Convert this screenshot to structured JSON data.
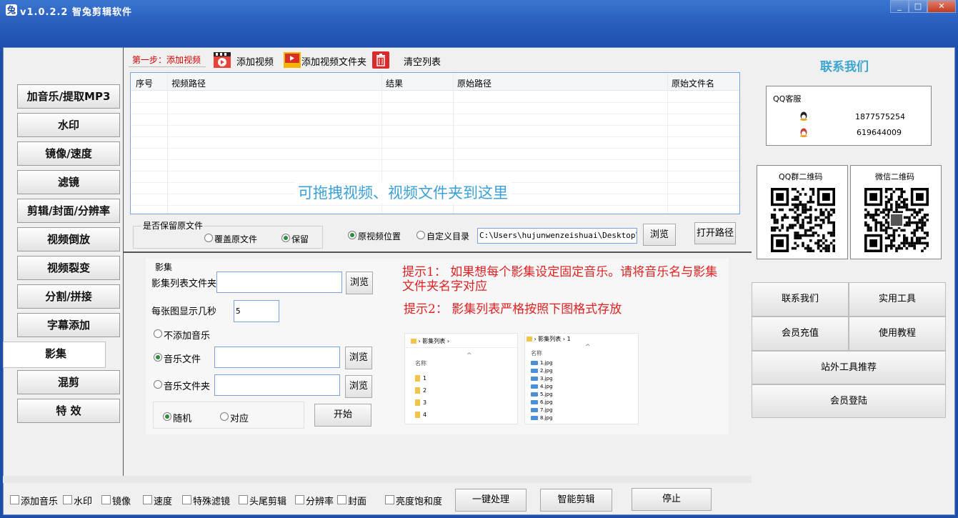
{
  "window": {
    "title": "v1.0.2.2 智兔剪辑软件",
    "minimize": "_",
    "maximize": "□",
    "close": "✕"
  },
  "nav": [
    "加音乐/提取MP3",
    "水印",
    "镜像/速度",
    "滤镜",
    "剪辑/封面/分辨率",
    "视频倒放",
    "视频裂变",
    "分割/拼接",
    "字幕添加",
    "影集",
    "混剪",
    "特 效"
  ],
  "nav_active_index": 9,
  "toolbar": {
    "step": "第一步：添加视频",
    "add_video": "添加视频",
    "add_folder": "添加视频文件夹",
    "clear": "清空列表"
  },
  "table": {
    "columns": [
      "序号",
      "视频路径",
      "结果",
      "原始路径",
      "原始文件名"
    ],
    "drop_hint": "可拖拽视频、视频文件夹到这里"
  },
  "keep": {
    "label": "是否保留原文件",
    "overwrite": "覆盖原文件",
    "keep": "保留",
    "selected": "keep"
  },
  "output": {
    "original": "原视频位置",
    "custom": "自定义目录",
    "path": "C:\\Users\\hujunwenzeishuai\\Desktop\\ztj",
    "browse": "浏览",
    "open": "打开路径",
    "selected": "original"
  },
  "album": {
    "group": "影集",
    "list_folder_label": "影集列表文件夹",
    "list_folder_value": "",
    "browse": "浏览",
    "seconds_label": "每张图显示几秒",
    "seconds_value": "5",
    "no_music": "不添加音乐",
    "music_file": "音乐文件",
    "music_folder": "音乐文件夹",
    "music_selected": "music_file",
    "random": "随机",
    "match": "对应",
    "order_selected": "random",
    "start": "开始"
  },
  "tips": {
    "tip1": "提示1：  如果想每个影集设定固定音乐。请将音乐名与影集文件夹名字对应",
    "tip2": "提示2：  影集列表严格按照下图格式存放"
  },
  "example": {
    "left_crumb": "影集列表",
    "left_header": "名称",
    "left_items": [
      "1",
      "2",
      "3",
      "4"
    ],
    "right_crumb": "影集列表",
    "right_crumb2": "1",
    "right_header": "名称",
    "right_items": [
      "1.jpg",
      "2.jpg",
      "3.jpg",
      "4.jpg",
      "5.jpg",
      "6.jpg",
      "7.jpg",
      "8.jpg"
    ]
  },
  "contact": {
    "title": "联系我们",
    "qq_service": "QQ客服",
    "qq1": "1877575254",
    "qq2": "619644009",
    "qq_group_qr": "QQ群二维码",
    "wechat_qr": "微信二维码"
  },
  "right_buttons": [
    "联系我们",
    "实用工具",
    "会员充值",
    "使用教程",
    "站外工具推荐",
    "会员登陆"
  ],
  "bottom": {
    "checks": [
      "添加音乐",
      "水印",
      "镜像",
      "速度",
      "特殊滤镜",
      "头尾剪辑",
      "分辨率",
      "封面",
      "亮度饱和度"
    ],
    "process": "一键处理",
    "smart": "智能剪辑",
    "stop": "停止"
  },
  "colors": {
    "title_bar": "#2a5fc0",
    "tip_red": "#e02020",
    "hint_blue": "#3aa0d8",
    "contact_teal": "#3aa5cf",
    "step_red": "#d60000"
  }
}
